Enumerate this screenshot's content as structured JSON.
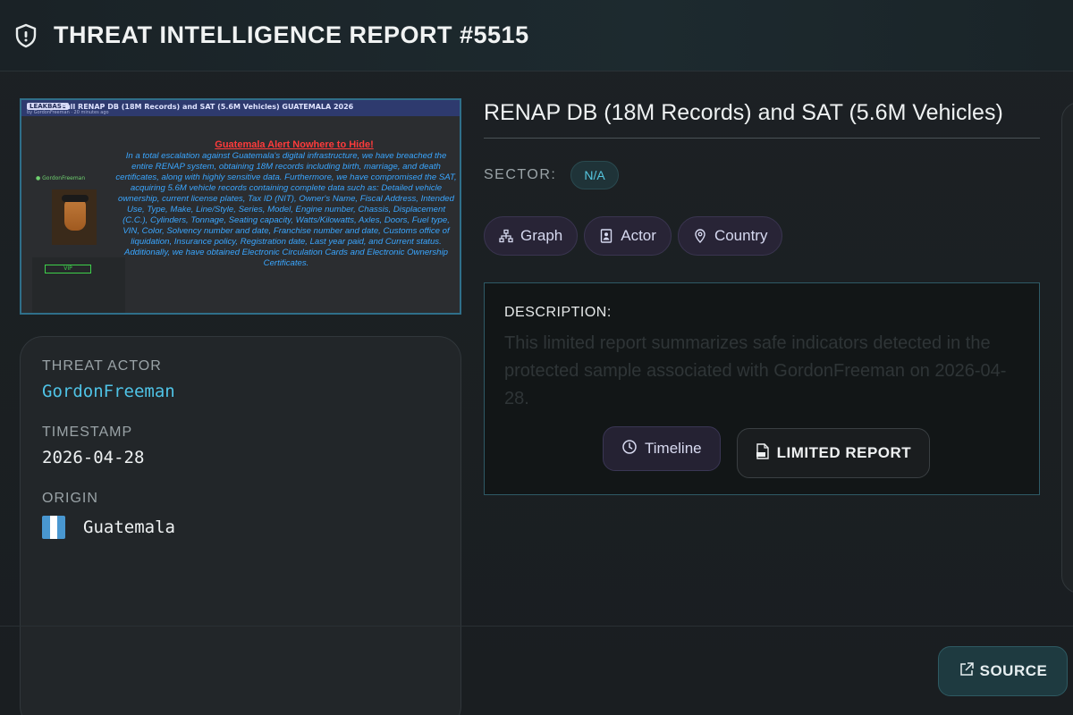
{
  "header": {
    "title": "THREAT INTELLIGENCE REPORT #5515"
  },
  "thumbnail": {
    "tag": "LEAKBASE",
    "post_title": "Full RENAP DB (18M Records) and SAT (5.6M Vehicles) GUATEMALA 2026",
    "post_sub": "by GordonFreeman · 20 minutes ago",
    "username": "● GordonFreeman",
    "vip": "VIP",
    "alert": "Guatemala Alert Nowhere to Hide!",
    "body": "In a total escalation against Guatemala's digital infrastructure, we have breached the entire RENAP system, obtaining 18M records including birth, marriage, and death certificates, along with highly sensitive data. Furthermore, we have compromised the SAT, acquiring 5.6M vehicle records containing complete data such as: Detailed vehicle ownership, current license plates, Tax ID (NIT), Owner's Name, Fiscal Address, Intended Use, Type, Make, Line/Style, Series, Model, Engine number, Chassis, Displacement (C.C.), Cylinders, Tonnage, Seating capacity, Watts/Kilowatts, Axles, Doors, Fuel type, VIN, Color, Solvency number and date, Franchise number and date, Customs office of liquidation, Insurance policy, Registration date, Last year paid, and Current status. Additionally, we have obtained Electronic Circulation Cards and Electronic Ownership Certificates."
  },
  "info": {
    "actor_label": "THREAT ACTOR",
    "actor": "GordonFreeman",
    "timestamp_label": "TIMESTAMP",
    "timestamp": "2026-04-28",
    "origin_label": "ORIGIN",
    "origin": "Guatemala"
  },
  "report": {
    "title": "RENAP DB (18M Records) and SAT (5.6M Vehicles)",
    "sector_label": "SECTOR:",
    "sector": "N/A",
    "pills": {
      "graph": "Graph",
      "actor": "Actor",
      "country": "Country"
    },
    "description_label": "DESCRIPTION:",
    "description": "This limited report summarizes safe indicators detected in the protected sample associated with GordonFreeman on 2026-04-28.",
    "timeline_label": "Timeline",
    "limited_label": "LIMITED REPORT"
  },
  "source_label": "SOURCE",
  "colors": {
    "accent": "#4fc3e6",
    "flag_blue": "#4997d0",
    "pill_bg": "#282436"
  },
  "icons": [
    "shield-icon",
    "graph-icon",
    "actor-icon",
    "location-pin-icon",
    "clock-icon",
    "pdf-icon",
    "external-link-icon"
  ]
}
